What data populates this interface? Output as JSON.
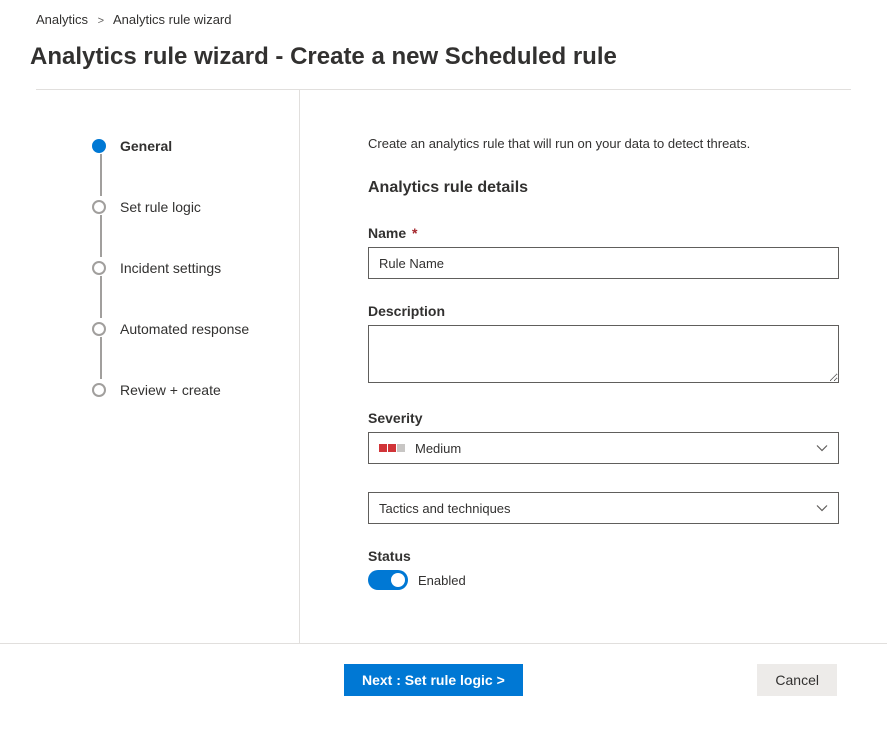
{
  "breadcrumb": {
    "root": "Analytics",
    "current": "Analytics rule wizard"
  },
  "page_title": "Analytics rule wizard - Create a new Scheduled rule",
  "steps": [
    {
      "label": "General",
      "active": true
    },
    {
      "label": "Set rule logic",
      "active": false
    },
    {
      "label": "Incident settings",
      "active": false
    },
    {
      "label": "Automated response",
      "active": false
    },
    {
      "label": "Review + create",
      "active": false
    }
  ],
  "main": {
    "intro": "Create an analytics rule that will run on your data to detect threats.",
    "section_heading": "Analytics rule details",
    "fields": {
      "name": {
        "label": "Name",
        "value": "Rule Name"
      },
      "description": {
        "label": "Description",
        "value": ""
      },
      "severity": {
        "label": "Severity",
        "value": "Medium"
      },
      "tactics": {
        "placeholder": "Tactics and techniques"
      },
      "status": {
        "label": "Status",
        "value_label": "Enabled"
      }
    }
  },
  "footer": {
    "next": "Next : Set rule logic >",
    "cancel": "Cancel"
  }
}
